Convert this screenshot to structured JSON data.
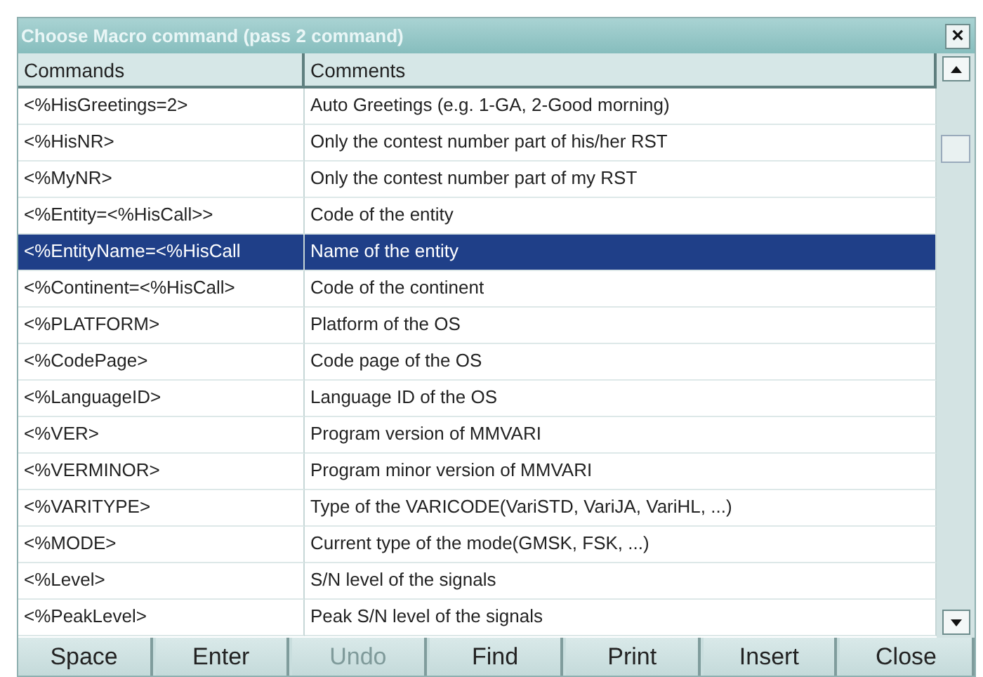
{
  "window": {
    "title": "Choose Macro command (pass 2 command)",
    "close": "×"
  },
  "table": {
    "columns": [
      "Commands",
      "Comments"
    ],
    "rows": [
      {
        "command": "<%HisGreetings=2>",
        "comment": "Auto Greetings (e.g. 1-GA, 2-Good morning)",
        "selected": false
      },
      {
        "command": "<%HisNR>",
        "comment": "Only the contest number part of his/her RST",
        "selected": false
      },
      {
        "command": "<%MyNR>",
        "comment": "Only the contest number part of my RST",
        "selected": false
      },
      {
        "command": "<%Entity=<%HisCall>>",
        "comment": "Code of the entity",
        "selected": false
      },
      {
        "command": "<%EntityName=<%HisCall",
        "comment": "Name of the entity",
        "selected": true
      },
      {
        "command": "<%Continent=<%HisCall>",
        "comment": "Code of the continent",
        "selected": false
      },
      {
        "command": "<%PLATFORM>",
        "comment": "Platform of the OS",
        "selected": false
      },
      {
        "command": "<%CodePage>",
        "comment": "Code page of the OS",
        "selected": false
      },
      {
        "command": "<%LanguageID>",
        "comment": "Language ID of the OS",
        "selected": false
      },
      {
        "command": "<%VER>",
        "comment": "Program version of MMVARI",
        "selected": false
      },
      {
        "command": "<%VERMINOR>",
        "comment": "Program minor version of MMVARI",
        "selected": false
      },
      {
        "command": "<%VARITYPE>",
        "comment": "Type of the VARICODE(VariSTD, VariJA, VariHL, ...)",
        "selected": false
      },
      {
        "command": "<%MODE>",
        "comment": "Current type of the mode(GMSK, FSK, ...)",
        "selected": false
      },
      {
        "command": "<%Level>",
        "comment": "S/N level of the signals",
        "selected": false
      },
      {
        "command": "<%PeakLevel>",
        "comment": "Peak S/N level of the signals",
        "selected": false
      }
    ]
  },
  "buttons": [
    {
      "label": "Space",
      "disabled": false
    },
    {
      "label": "Enter",
      "disabled": false
    },
    {
      "label": "Undo",
      "disabled": true
    },
    {
      "label": "Find",
      "disabled": false
    },
    {
      "label": "Print",
      "disabled": false
    },
    {
      "label": "Insert",
      "disabled": false
    },
    {
      "label": "Close",
      "disabled": false
    }
  ]
}
